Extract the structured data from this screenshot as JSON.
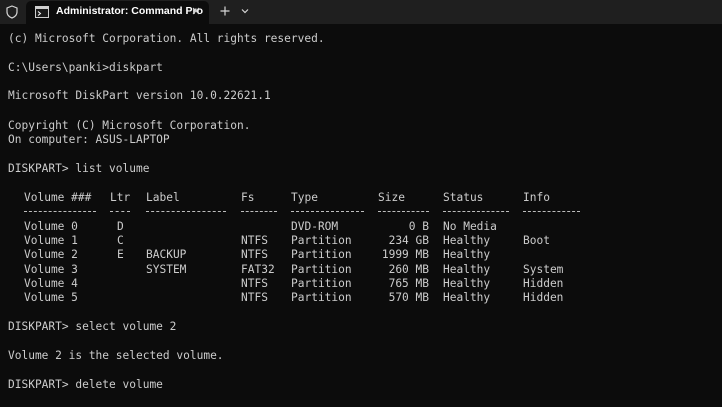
{
  "window": {
    "tab_title": "Administrator: Command Pro",
    "icons": {
      "shield": "shield-icon",
      "tab": "terminal-icon",
      "close": "close-icon",
      "new_tab": "plus-icon",
      "dropdown": "chevron-down-icon"
    }
  },
  "console": {
    "lines": {
      "copyright_ms": "(c) Microsoft Corporation. All rights reserved.",
      "prompt_diskpart": "C:\\Users\\panki>diskpart",
      "dp_version": "Microsoft DiskPart version 10.0.22621.1",
      "dp_copyright": "Copyright (C) Microsoft Corporation.",
      "dp_computer": "On computer: ASUS-LAPTOP",
      "cmd_list": "DISKPART> list volume",
      "cmd_select": "DISKPART> select volume 2",
      "msg_selected": "Volume 2 is the selected volume.",
      "cmd_delete": "DISKPART> delete volume"
    },
    "volume_table": {
      "headers": {
        "volume": "Volume ###",
        "ltr": "Ltr",
        "label": "Label",
        "fs": "Fs",
        "type": "Type",
        "size": "Size",
        "status": "Status",
        "info": "Info"
      },
      "rows": [
        {
          "volume": "Volume 0",
          "ltr": "D",
          "label": "",
          "fs": "",
          "type": "DVD-ROM",
          "size": "0 B",
          "status": "No Media",
          "info": ""
        },
        {
          "volume": "Volume 1",
          "ltr": "C",
          "label": "",
          "fs": "NTFS",
          "type": "Partition",
          "size": "234 GB",
          "status": "Healthy",
          "info": "Boot"
        },
        {
          "volume": "Volume 2",
          "ltr": "E",
          "label": "BACKUP",
          "fs": "NTFS",
          "type": "Partition",
          "size": "1999 MB",
          "status": "Healthy",
          "info": ""
        },
        {
          "volume": "Volume 3",
          "ltr": "",
          "label": "SYSTEM",
          "fs": "FAT32",
          "type": "Partition",
          "size": "260 MB",
          "status": "Healthy",
          "info": "System"
        },
        {
          "volume": "Volume 4",
          "ltr": "",
          "label": "",
          "fs": "NTFS",
          "type": "Partition",
          "size": "765 MB",
          "status": "Healthy",
          "info": "Hidden"
        },
        {
          "volume": "Volume 5",
          "ltr": "",
          "label": "",
          "fs": "NTFS",
          "type": "Partition",
          "size": "570 MB",
          "status": "Healthy",
          "info": "Hidden"
        }
      ]
    }
  },
  "colors": {
    "console_bg": "#0c0c0c",
    "titlebar_bg": "#1f1f1f",
    "console_text": "#cccccc"
  }
}
